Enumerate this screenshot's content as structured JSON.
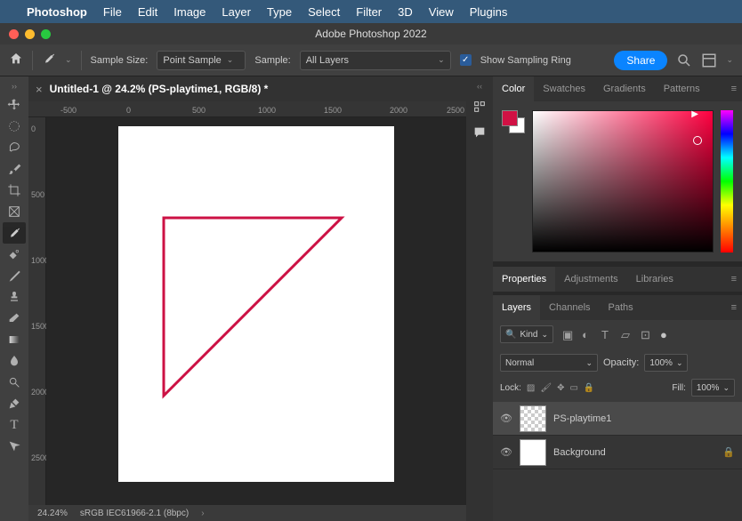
{
  "menubar": {
    "app": "Photoshop",
    "items": [
      "File",
      "Edit",
      "Image",
      "Layer",
      "Type",
      "Select",
      "Filter",
      "3D",
      "View",
      "Plugins"
    ]
  },
  "window": {
    "title": "Adobe Photoshop 2022"
  },
  "optionbar": {
    "sample_size_label": "Sample Size:",
    "sample_size_value": "Point Sample",
    "sample_label": "Sample:",
    "sample_value": "All Layers",
    "show_ring": "Show Sampling Ring",
    "share": "Share"
  },
  "document": {
    "tab_title": "Untitled-1 @ 24.2% (PS-playtime1, RGB/8) *",
    "rulerH": [
      "-500",
      "0",
      "500",
      "1000",
      "1500",
      "2000",
      "2500"
    ],
    "rulerV": [
      "0",
      "500",
      "1000",
      "1500",
      "2000",
      "2500"
    ]
  },
  "statusbar": {
    "zoom": "24.24%",
    "profile": "sRGB IEC61966-2.1 (8bpc)"
  },
  "panels": {
    "color_tabs": [
      "Color",
      "Swatches",
      "Gradients",
      "Patterns"
    ],
    "prop_tabs": [
      "Properties",
      "Adjustments",
      "Libraries"
    ],
    "layer_tabs": [
      "Layers",
      "Channels",
      "Paths"
    ],
    "kind": "Kind",
    "blend": "Normal",
    "opacity_label": "Opacity:",
    "opacity_value": "100%",
    "lock_label": "Lock:",
    "fill_label": "Fill:",
    "fill_value": "100%",
    "layers": [
      {
        "name": "PS-playtime1",
        "locked": false
      },
      {
        "name": "Background",
        "locked": true
      }
    ]
  }
}
